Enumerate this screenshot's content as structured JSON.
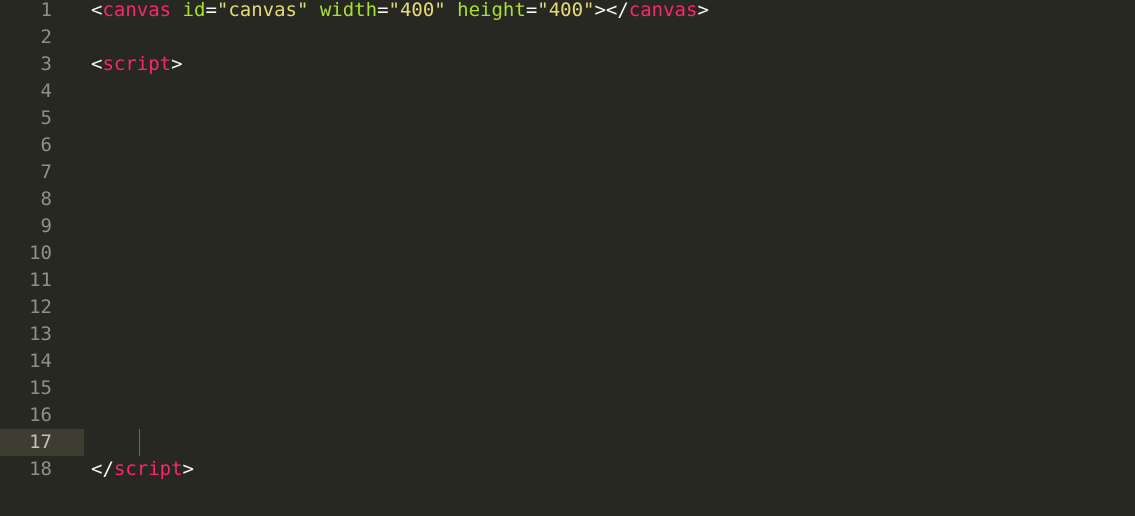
{
  "editor": {
    "colors": {
      "background": "#272822",
      "line_number": "#8f908a",
      "active_line": "#3e3d32",
      "tag": "#f92672",
      "attribute": "#a6e22e",
      "string": "#e6db74",
      "punctuation": "#f8f8f2"
    },
    "active_line": 17,
    "lines": [
      {
        "number": "1",
        "tokens": [
          {
            "t": "punct",
            "v": "<"
          },
          {
            "t": "tag",
            "v": "canvas"
          },
          {
            "t": "punct",
            "v": " "
          },
          {
            "t": "attr",
            "v": "id"
          },
          {
            "t": "punct",
            "v": "="
          },
          {
            "t": "str",
            "v": "\"canvas\""
          },
          {
            "t": "punct",
            "v": " "
          },
          {
            "t": "attr",
            "v": "width"
          },
          {
            "t": "punct",
            "v": "="
          },
          {
            "t": "str",
            "v": "\"400\""
          },
          {
            "t": "punct",
            "v": " "
          },
          {
            "t": "attr",
            "v": "height"
          },
          {
            "t": "punct",
            "v": "="
          },
          {
            "t": "str",
            "v": "\"400\""
          },
          {
            "t": "punct",
            "v": "></"
          },
          {
            "t": "tag",
            "v": "canvas"
          },
          {
            "t": "punct",
            "v": ">"
          }
        ]
      },
      {
        "number": "2",
        "tokens": []
      },
      {
        "number": "3",
        "tokens": [
          {
            "t": "punct",
            "v": "<"
          },
          {
            "t": "tag",
            "v": "script"
          },
          {
            "t": "punct",
            "v": ">"
          }
        ]
      },
      {
        "number": "4",
        "tokens": []
      },
      {
        "number": "5",
        "tokens": []
      },
      {
        "number": "6",
        "tokens": []
      },
      {
        "number": "7",
        "tokens": []
      },
      {
        "number": "8",
        "tokens": []
      },
      {
        "number": "9",
        "tokens": []
      },
      {
        "number": "10",
        "tokens": []
      },
      {
        "number": "11",
        "tokens": []
      },
      {
        "number": "12",
        "tokens": []
      },
      {
        "number": "13",
        "tokens": []
      },
      {
        "number": "14",
        "tokens": []
      },
      {
        "number": "15",
        "tokens": []
      },
      {
        "number": "16",
        "tokens": []
      },
      {
        "number": "17",
        "tokens": []
      },
      {
        "number": "18",
        "tokens": [
          {
            "t": "punct",
            "v": "</"
          },
          {
            "t": "tag",
            "v": "script"
          },
          {
            "t": "punct",
            "v": ">"
          }
        ]
      }
    ]
  }
}
